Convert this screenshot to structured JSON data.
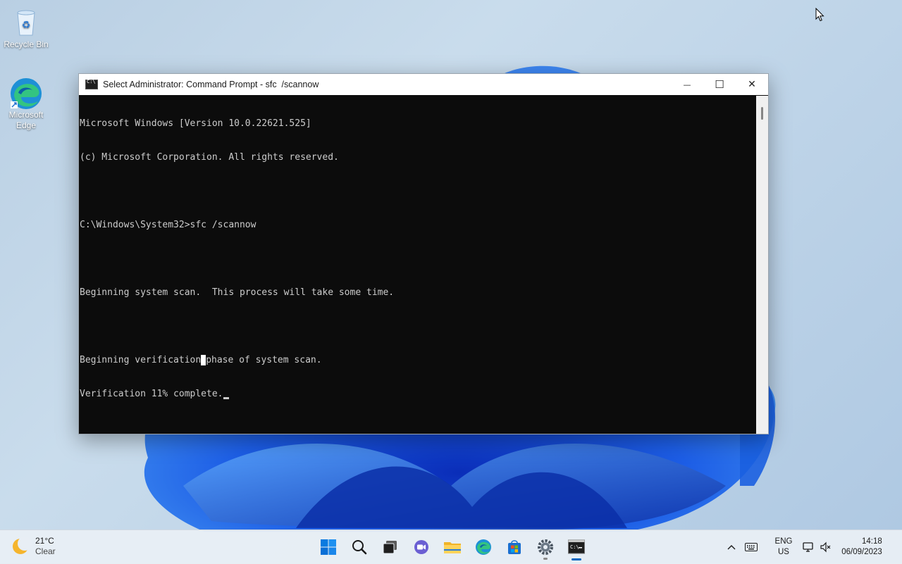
{
  "desktop": {
    "icons": [
      {
        "label": "Recycle Bin"
      },
      {
        "label": "Microsoft Edge"
      }
    ]
  },
  "window": {
    "title": "Select Administrator: Command Prompt - sfc  /scannow",
    "controls": {
      "minimize": "—",
      "maximize": "☐",
      "close": "✕"
    }
  },
  "console": {
    "lines": [
      "Microsoft Windows [Version 10.0.22621.525]",
      "(c) Microsoft Corporation. All rights reserved.",
      "",
      "C:\\Windows\\System32>sfc /scannow",
      "",
      "Beginning system scan.  This process will take some time.",
      "",
      "Beginning verification phase of system scan.",
      "Verification 11% complete."
    ],
    "line8_before": "Beginning verification",
    "line8_after": "phase of system scan."
  },
  "taskbar": {
    "weather": {
      "temp": "21°C",
      "condition": "Clear"
    },
    "apps": [
      "start-icon",
      "search-icon",
      "task-view-icon",
      "teams-chat-icon",
      "file-explorer-icon",
      "edge-icon",
      "store-icon",
      "settings-icon",
      "terminal-icon"
    ],
    "lang": {
      "line1": "ENG",
      "line2": "US"
    },
    "clock": {
      "time": "14:18",
      "date": "06/09/2023"
    }
  },
  "colors": {
    "accent": "#0067c0",
    "console_bg": "#0c0c0c",
    "console_fg": "#cccccc"
  }
}
